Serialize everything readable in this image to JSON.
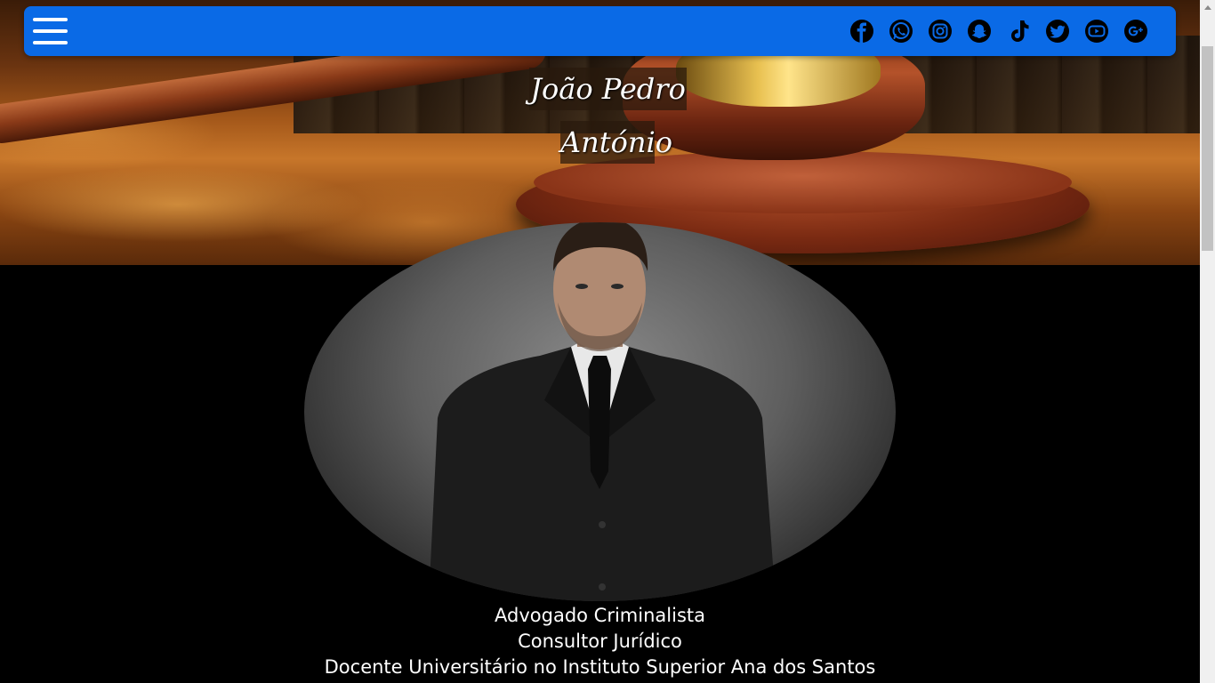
{
  "hero": {
    "title_line1": "João Pedro",
    "title_line2": "António"
  },
  "navbar": {
    "color": "#0a6ae6",
    "menu_icon": "hamburger-menu-icon",
    "social_icons": [
      "facebook-icon",
      "whatsapp-icon",
      "instagram-icon",
      "snapchat-icon",
      "tiktok-icon",
      "twitter-icon",
      "youtube-icon",
      "google-plus-icon"
    ]
  },
  "profile": {
    "lines": [
      "Advogado Criminalista",
      "Consultor Jurídico",
      "Docente Universitário no Instituto Superior Ana dos Santos"
    ]
  }
}
